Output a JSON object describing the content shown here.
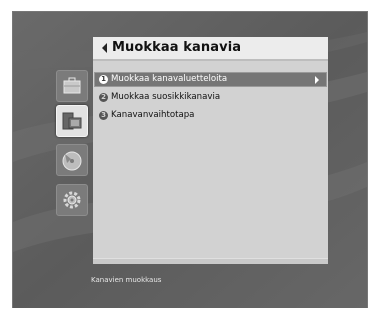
{
  "menu": {
    "title": "Muokkaa kanavia",
    "items": [
      {
        "number": "1",
        "label": "Muokkaa kanavaluetteloita",
        "selected": true
      },
      {
        "number": "2",
        "label": "Muokkaa suosikkikanavia",
        "selected": false
      },
      {
        "number": "3",
        "label": "Kanavanvaihtotapa",
        "selected": false
      }
    ]
  },
  "status": {
    "text": "Kanavien muokkaus"
  },
  "sidebar": {
    "icons": [
      {
        "name": "briefcase-icon",
        "active": false
      },
      {
        "name": "channels-icon",
        "active": true
      },
      {
        "name": "disc-icon",
        "active": false
      },
      {
        "name": "gear-icon",
        "active": false
      }
    ]
  },
  "colors": {
    "background": "#5f5f5f",
    "panel": "#d2d2d2",
    "title_bar": "#ececec",
    "selection": "#767676"
  }
}
